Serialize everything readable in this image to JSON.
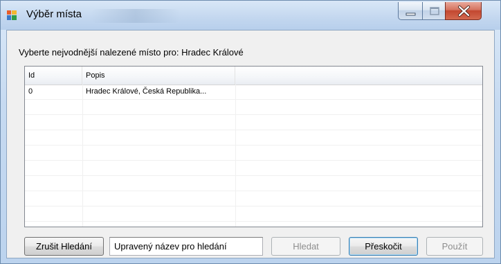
{
  "window": {
    "title": "Výběr místa"
  },
  "prompt": "Vyberte nejvodnější nalezené místo pro: Hradec Králové",
  "table": {
    "columns": [
      "Id",
      "Popis",
      ""
    ],
    "rows": [
      {
        "id": "0",
        "popis": "Hradec Králové, Česká Republika..."
      }
    ]
  },
  "toolbar": {
    "cancel_search_label": "Zrušit Hledání",
    "search_input_value": "Upravený název pro hledání",
    "search_label": "Hledat",
    "skip_label": "Přeskočit",
    "use_label": "Použít"
  },
  "colors": {
    "title_bar": "#c3d7ef",
    "close_button": "#c24730",
    "dialog_background": "#f0f0f0",
    "default_button_border": "#3c7fb1"
  },
  "icons": {
    "app": "window-app-icon",
    "minimize": "minimize-icon",
    "maximize": "maximize-icon",
    "close": "close-icon"
  }
}
